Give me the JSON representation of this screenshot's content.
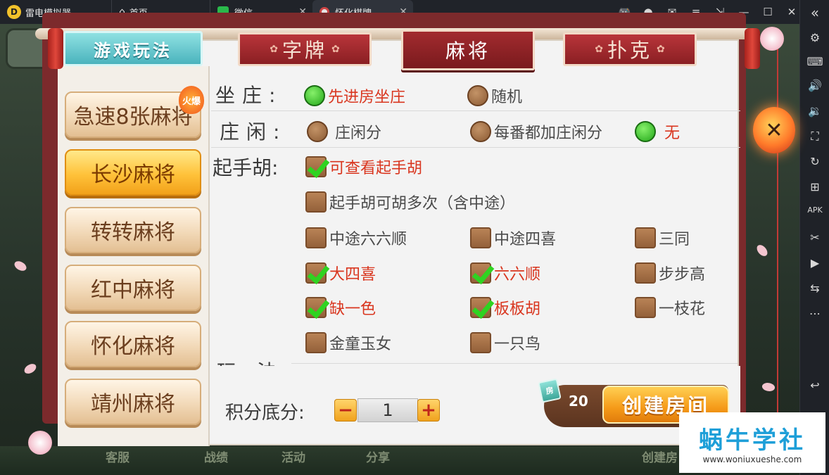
{
  "titlebar": {
    "emulator_name": "雷电模拟器",
    "tabs": [
      {
        "label": "首页"
      },
      {
        "label": "微信"
      },
      {
        "label": "怀化棋牌"
      }
    ]
  },
  "dialog": {
    "rules_tab": "游戏玩法",
    "category_tabs": [
      {
        "label": "字牌",
        "active": false
      },
      {
        "label": "麻将",
        "active": true
      },
      {
        "label": "扑克",
        "active": false
      }
    ],
    "games": [
      {
        "label": "急速8张麻将",
        "badge": "火爆"
      },
      {
        "label": "长沙麻将",
        "selected": true
      },
      {
        "label": "转转麻将"
      },
      {
        "label": "红中麻将"
      },
      {
        "label": "怀化麻将"
      },
      {
        "label": "靖州麻将"
      }
    ],
    "rows": {
      "zuozhuang": {
        "label": "坐庄:",
        "options": [
          {
            "label": "先进房坐庄",
            "selected": true
          },
          {
            "label": "随机",
            "selected": false
          }
        ]
      },
      "zhuangxian": {
        "label": "庄闲:",
        "options": [
          {
            "label": "庄闲分",
            "selected": false
          },
          {
            "label": "每番都加庄闲分",
            "selected": false
          },
          {
            "label": "无",
            "selected": true
          }
        ]
      },
      "qishouhu": {
        "label": "起手胡:",
        "options": [
          {
            "label": "可查看起手胡",
            "checked": true
          },
          {
            "label": "起手胡可胡多次（含中途）",
            "checked": false
          },
          {
            "label": "中途六六顺",
            "checked": false
          },
          {
            "label": "中途四喜",
            "checked": false
          },
          {
            "label": "三同",
            "checked": false
          },
          {
            "label": "大四喜",
            "checked": true
          },
          {
            "label": "六六顺",
            "checked": true
          },
          {
            "label": "步步高",
            "checked": false
          },
          {
            "label": "缺一色",
            "checked": true
          },
          {
            "label": "板板胡",
            "checked": true
          },
          {
            "label": "一枝花",
            "checked": false
          },
          {
            "label": "金童玉女",
            "checked": false
          },
          {
            "label": "一只鸟",
            "checked": false
          }
        ]
      },
      "wanfa_partial": "玩  法"
    },
    "score": {
      "label": "积分底分:",
      "minus": "−",
      "plus": "+",
      "value": "1"
    },
    "create": {
      "card_icon": "房",
      "card_count": "20",
      "button": "创建房间"
    },
    "close_glyph": "✕"
  },
  "background_bar": {
    "items": [
      "客服",
      "战绩",
      "活动",
      "分享",
      "创建房"
    ]
  },
  "watermark": {
    "title": "蜗牛学社",
    "url": "www.woniuxueshe.com"
  },
  "colors": {
    "accent_red": "#d9361f",
    "check_green": "#2fd321",
    "teal_tab": "#4ab3bd",
    "orange_button": "#f59a18"
  }
}
